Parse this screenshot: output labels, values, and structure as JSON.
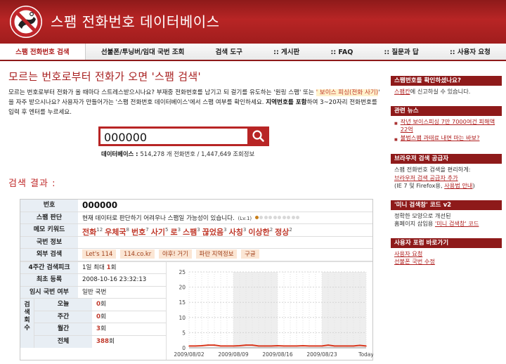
{
  "app": {
    "title": "스팸 전화번호 데이터베이스"
  },
  "nav": {
    "items": [
      {
        "label": "스팸 전화번호 검색"
      },
      {
        "label": "선불폰/투닝버/임대 국번 조회"
      },
      {
        "label": "검색 도구"
      },
      {
        "label": ":: 게시판"
      },
      {
        "label": ":: FAQ"
      },
      {
        "label": ":: 질문과 답"
      },
      {
        "label": ":: 사용자 요청"
      }
    ]
  },
  "main": {
    "headline": "모르는 번호로부터 전화가 오면 '스팸 검색'",
    "intro": {
      "part1": "모르는 번호로부터 전화가 올 때마다 스트레스받으시나요? 부재중 전화번호를 남기고 되 걸기를 유도하는 '원링 스팸' 또는",
      "highlight": "' 보이스 피싱(전화 사기)",
      "part2": "' 을 자주 받으시나요? 사용자가 만들어가는 '스팸 전화번호 데이터베이스'에서 스팸 여부를 확인하세요.",
      "bold1": "지역번호를 포함",
      "part3": "하여 3~20자리 전화번호를 입력 후 엔터를 누르세요."
    },
    "search": {
      "value": "000000"
    },
    "stats": {
      "label": "데이터베이스 : ",
      "phones": "514,278",
      "phones_unit": " 개 전화번호 / ",
      "views": "1,447,649",
      "views_unit": " 조회정보"
    },
    "results_title": "검색 결과 :"
  },
  "result": {
    "number_label": "번호",
    "number": "000000",
    "judge_label": "스팸 판단",
    "judge_text": "현재 데이터로 판단하기 어려우나 스팸일 가능성이 있습니다.",
    "level": "(Lv.1)",
    "level_value": 1,
    "level_max": 10,
    "keyword_label": "메모 키워드",
    "keywords": [
      {
        "word": "전화",
        "count": "12"
      },
      {
        "word": "우체국",
        "count": "8"
      },
      {
        "word": "번호",
        "count": "7"
      },
      {
        "word": "사기",
        "count": "5"
      },
      {
        "word": "로",
        "count": "3"
      },
      {
        "word": "스팸",
        "count": "3"
      },
      {
        "word": "끊었음",
        "count": "3"
      },
      {
        "word": "사칭",
        "count": "3"
      },
      {
        "word": "이상한",
        "count": "2"
      },
      {
        "word": "정상",
        "count": "2"
      }
    ],
    "bureau_label": "국번 정보",
    "bureau_value": "",
    "external_label": "외부 검색",
    "external_links": [
      "Let's 114",
      "114.co.kr",
      "야후! 거기",
      "파란 지역정보",
      "구글"
    ],
    "peak_label": "4주간 검색피크",
    "peak_value": "1일 최대 ",
    "peak_count": "1",
    "peak_unit": "회",
    "first_label": "최초 등록",
    "first_value": "2008-10-16 23:32:13",
    "temp_label": "임시 국번 여부",
    "temp_value": "일반 국번",
    "count_group_label": "검색회수",
    "counts": [
      {
        "label": "오늘",
        "value": "0",
        "unit": "회"
      },
      {
        "label": "주간",
        "value": "0",
        "unit": "회"
      },
      {
        "label": "월간",
        "value": "3",
        "unit": "회"
      },
      {
        "label": "전체",
        "value": "388",
        "unit": "회"
      }
    ]
  },
  "chart_data": {
    "type": "line",
    "x_ticks": [
      "2009/08/02",
      "2009/08/09",
      "2009/08/16",
      "2009/08/23",
      "Today"
    ],
    "y_ticks": [
      "25",
      "20",
      "15",
      "10",
      "5",
      "0"
    ],
    "ylim": [
      0,
      25
    ],
    "grid": true,
    "values": [
      0.6,
      0.6,
      0.7,
      0.9,
      0.9,
      0.6,
      0.6,
      0.6,
      0.7,
      0.9,
      0.9,
      0.6,
      0.6,
      0.6,
      0.7,
      0.6,
      0.6,
      0.6,
      0.7,
      0.6,
      0.6,
      0.6,
      0.9,
      0.6,
      0.6,
      0.6,
      0.6,
      0.8,
      0.6
    ],
    "line_color": "#d9381e"
  },
  "sidebar": {
    "box1": {
      "title": "스팸번호를 확인하셨나요?",
      "link": "스팸칸",
      "text": "에 신고하실 수 있습니다."
    },
    "box2": {
      "title": "관련 뉴스",
      "items": [
        "작년 보이스피싱 7만 7000여건 피해액 22억",
        "불법스팸 과태료 내면 마는 바보?"
      ]
    },
    "box3": {
      "title": "브라우저 검색 공급자",
      "line1": "스팸 전화번호 검색을 편리하게:",
      "link1": "브라우저 검색 공급자 추가",
      "line2a": "(IE 7 및 Firefox용, ",
      "link2": "사용법 안내",
      "line2b": ")"
    },
    "box4": {
      "title": "'미니 검색창' 코드 v2",
      "line1": "정확한 모양으로 개선된",
      "line2a": "홈페이지 삽입용 ",
      "link": "'미니 검색창' 코드"
    },
    "box5": {
      "title": "사용자 포럼 바로가기",
      "links": [
        "사용자 요청",
        "선불폰 국번 수정"
      ]
    }
  },
  "colors": {
    "brand": "#a01d1d",
    "accent_red": "#c0392b",
    "label_bg": "#e8eef4"
  }
}
